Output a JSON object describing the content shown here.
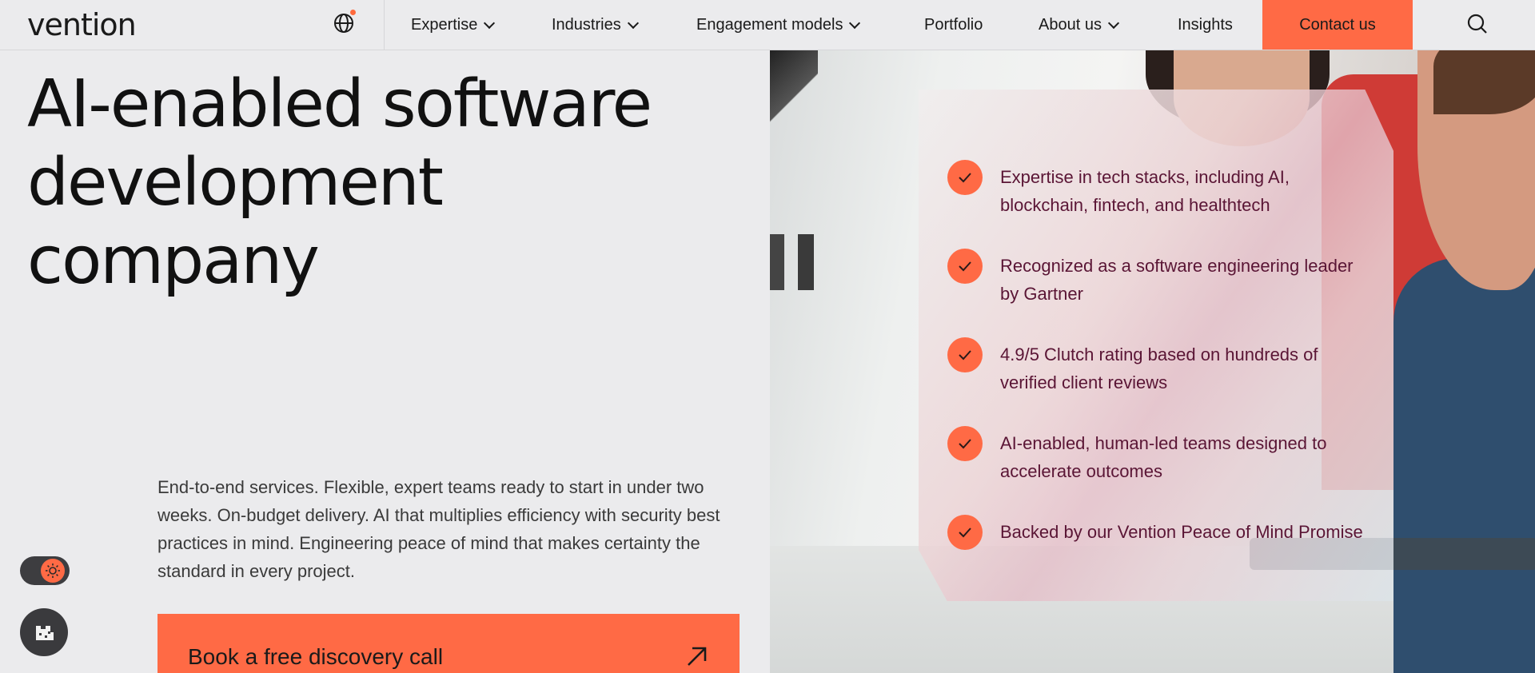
{
  "header": {
    "logo": "vention",
    "nav": [
      {
        "label": "Expertise",
        "has_dropdown": true
      },
      {
        "label": "Industries",
        "has_dropdown": true
      },
      {
        "label": "Engagement models",
        "has_dropdown": true
      },
      {
        "label": "Portfolio",
        "has_dropdown": false
      },
      {
        "label": "About us",
        "has_dropdown": true
      },
      {
        "label": "Insights",
        "has_dropdown": false
      }
    ],
    "contact_label": "Contact us",
    "icons": [
      "globe-icon",
      "search-icon",
      "chevron-down-icon"
    ]
  },
  "hero": {
    "title": "AI-enabled software development company",
    "description": "End-to-end services. Flexible, expert teams ready to start in under two weeks. On-budget delivery. AI that multiplies efficiency with security best practices in mind. Engineering peace of mind that makes certainty the standard in every project.",
    "cta_label": "Book a free discovery call"
  },
  "benefits": [
    "Expertise in tech stacks, including AI, blockchain, fintech, and healthtech",
    "Recognized as a software engineering leader by Gartner",
    "4.9/5 Clutch rating based on hundreds of verified client reviews",
    "AI-enabled, human-led teams designed to accelerate outcomes",
    "Backed by our Vention Peace of Mind Promise"
  ],
  "widgets": {
    "theme_toggle_icon": "sun-icon",
    "cookie_icon": "cookie-icon"
  },
  "colors": {
    "accent": "#ff6a45",
    "background": "#ebebed",
    "benefit_text": "#5a1535"
  }
}
